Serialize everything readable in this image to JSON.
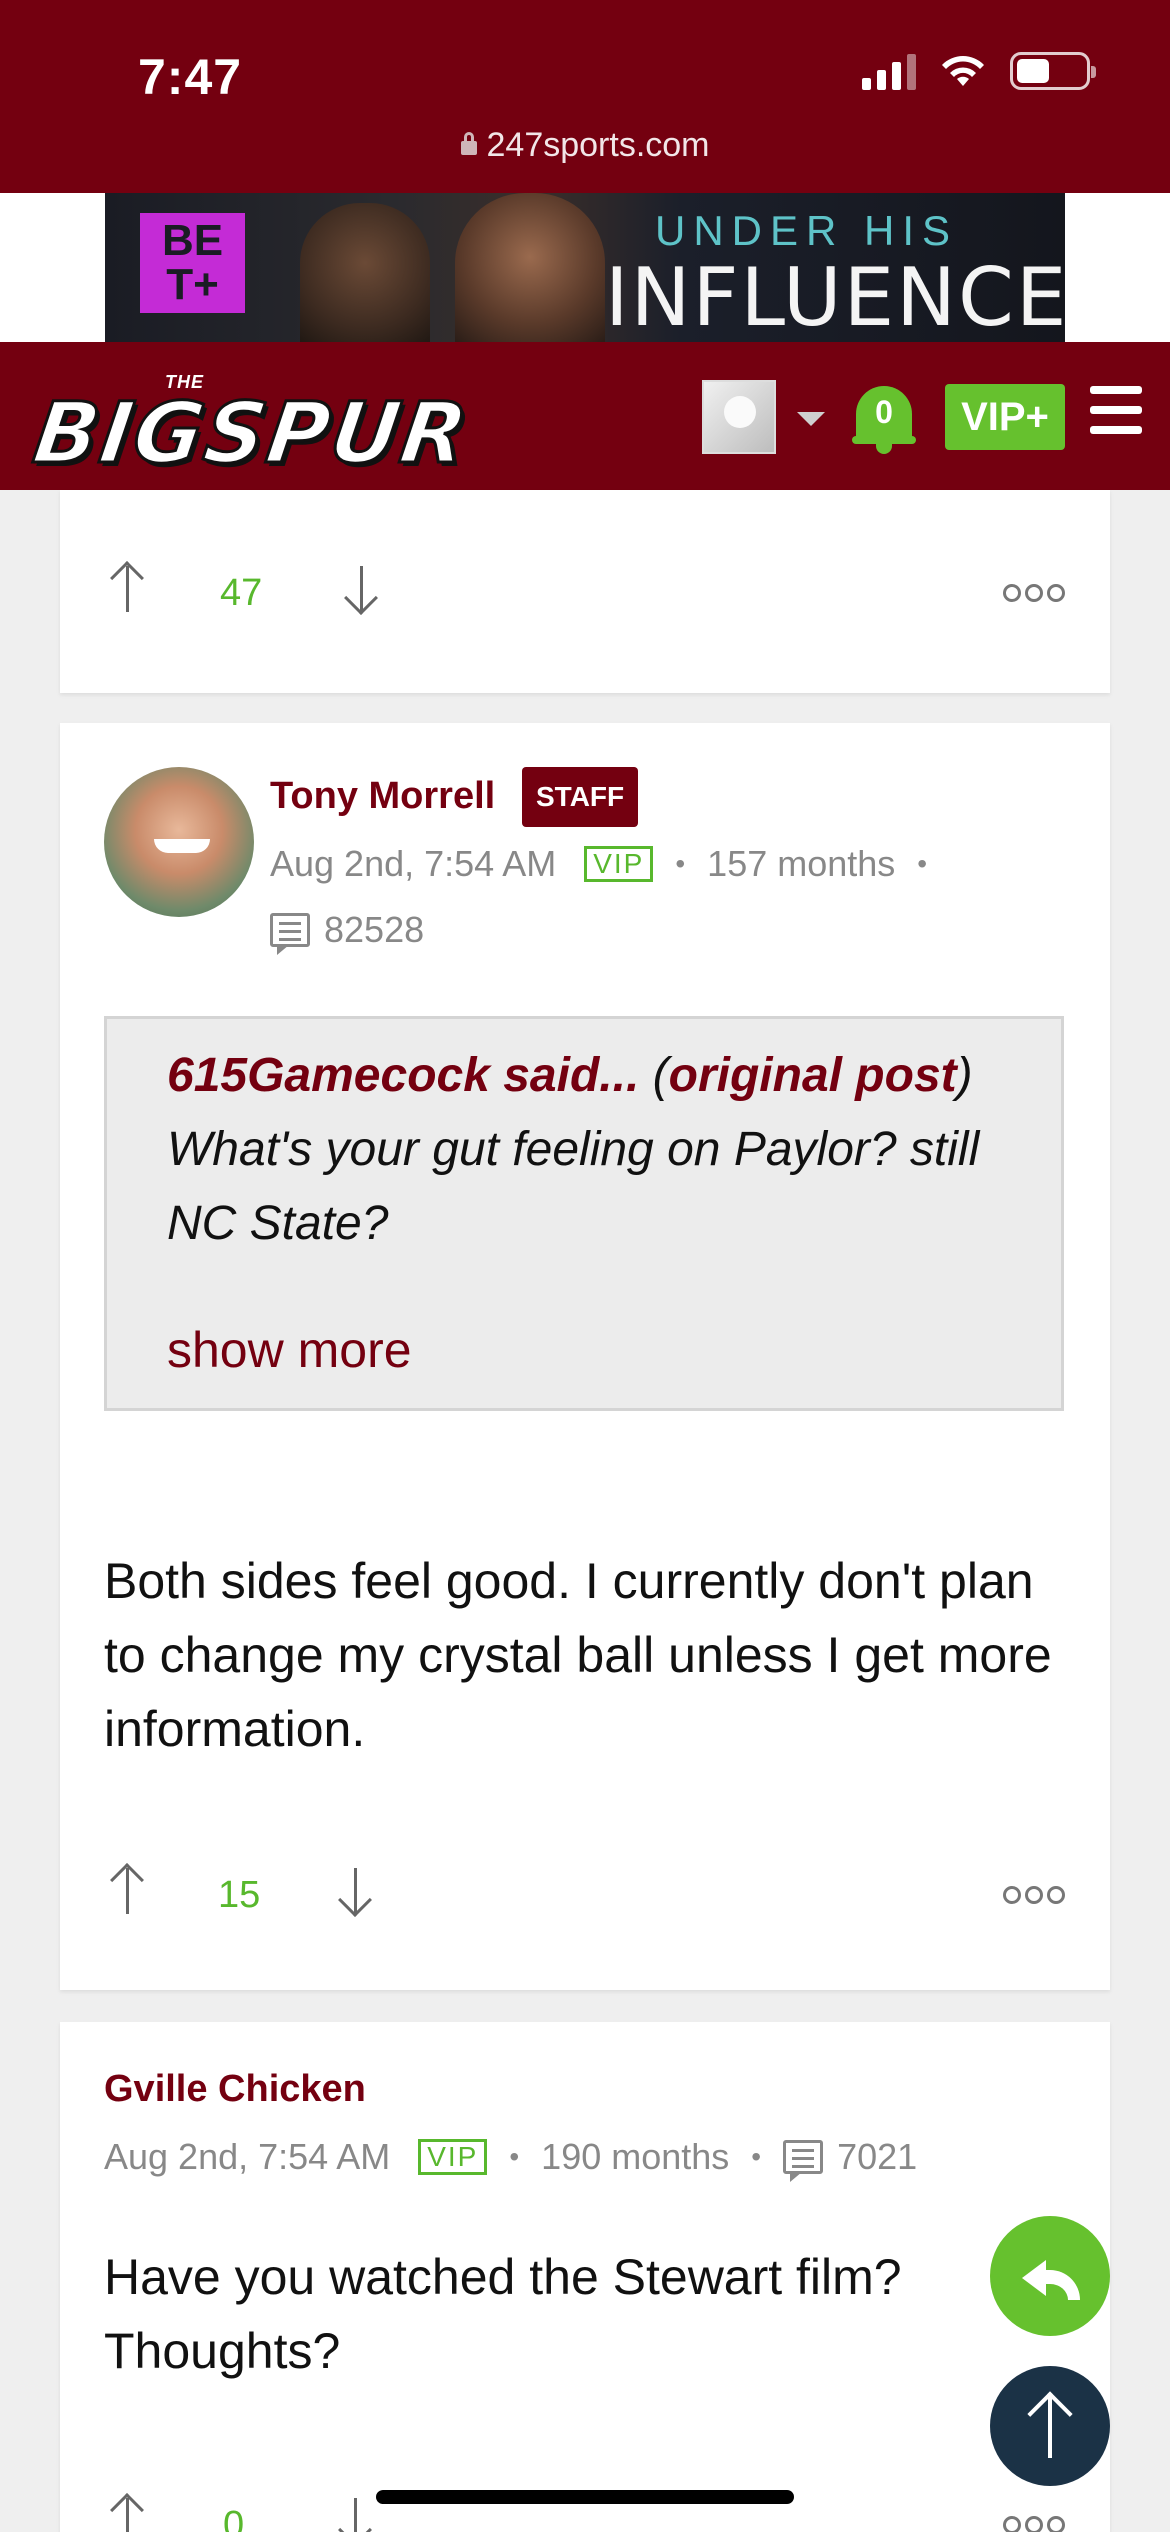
{
  "status_bar": {
    "time": "7:47"
  },
  "browser": {
    "url": "247sports.com"
  },
  "ad": {
    "logo": "BE T+",
    "subtitle": "UNDER HIS",
    "title": "INFLUENCE"
  },
  "site_header": {
    "brand_small": "THE",
    "brand_name": "BIGSPUR",
    "notification_count": "0",
    "vip_label": "VIP+"
  },
  "posts": [
    {
      "votes": "47"
    },
    {
      "author": "Tony Morrell",
      "badge": "STAFF",
      "date": "Aug 2nd, 7:54 AM",
      "vip": "VIP",
      "tenure": "157 months",
      "post_count": "82528",
      "quote": {
        "author_said": "615Gamecock said...",
        "open_paren": " (",
        "link": "original post",
        "text": ") What's your gut feeling on Paylor? still NC State?",
        "show_more": "show more"
      },
      "body": "Both sides feel good. I currently don't plan to change my crystal ball unless I get more information.",
      "votes": "15"
    },
    {
      "author": "Gville Chicken",
      "date": "Aug 2nd, 7:54 AM",
      "vip": "VIP",
      "tenure": "190 months",
      "post_count": "7021",
      "body": "Have you watched the Stewart film? Thoughts?",
      "votes": "0"
    }
  ],
  "colors": {
    "brand": "#740010",
    "accent_green": "#66c12e",
    "scroll_top": "#1b3246"
  },
  "icons": [
    "lock-icon",
    "signal-icon",
    "wifi-icon",
    "battery-icon",
    "notification-bell-icon",
    "hamburger-menu-icon",
    "upvote-icon",
    "downvote-icon",
    "more-options-icon",
    "comment-count-icon",
    "reply-icon",
    "scroll-to-top-icon"
  ]
}
